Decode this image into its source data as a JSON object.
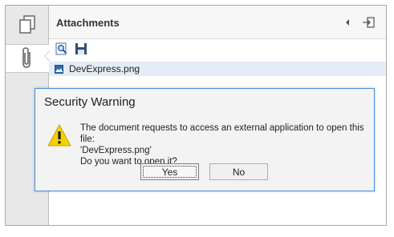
{
  "panel": {
    "title": "Attachments",
    "file_name": "DevExpress.png"
  },
  "sidebar": {
    "items": [
      {
        "name": "pages-icon"
      },
      {
        "name": "paperclip-icon"
      }
    ]
  },
  "dialog": {
    "title": "Security Warning",
    "message_line1": "The document requests to access an external application to open this file:",
    "message_line2": "'DevExpress.png'",
    "message_line3": "Do you want to open it?",
    "yes_label": "Yes",
    "no_label": "No"
  }
}
